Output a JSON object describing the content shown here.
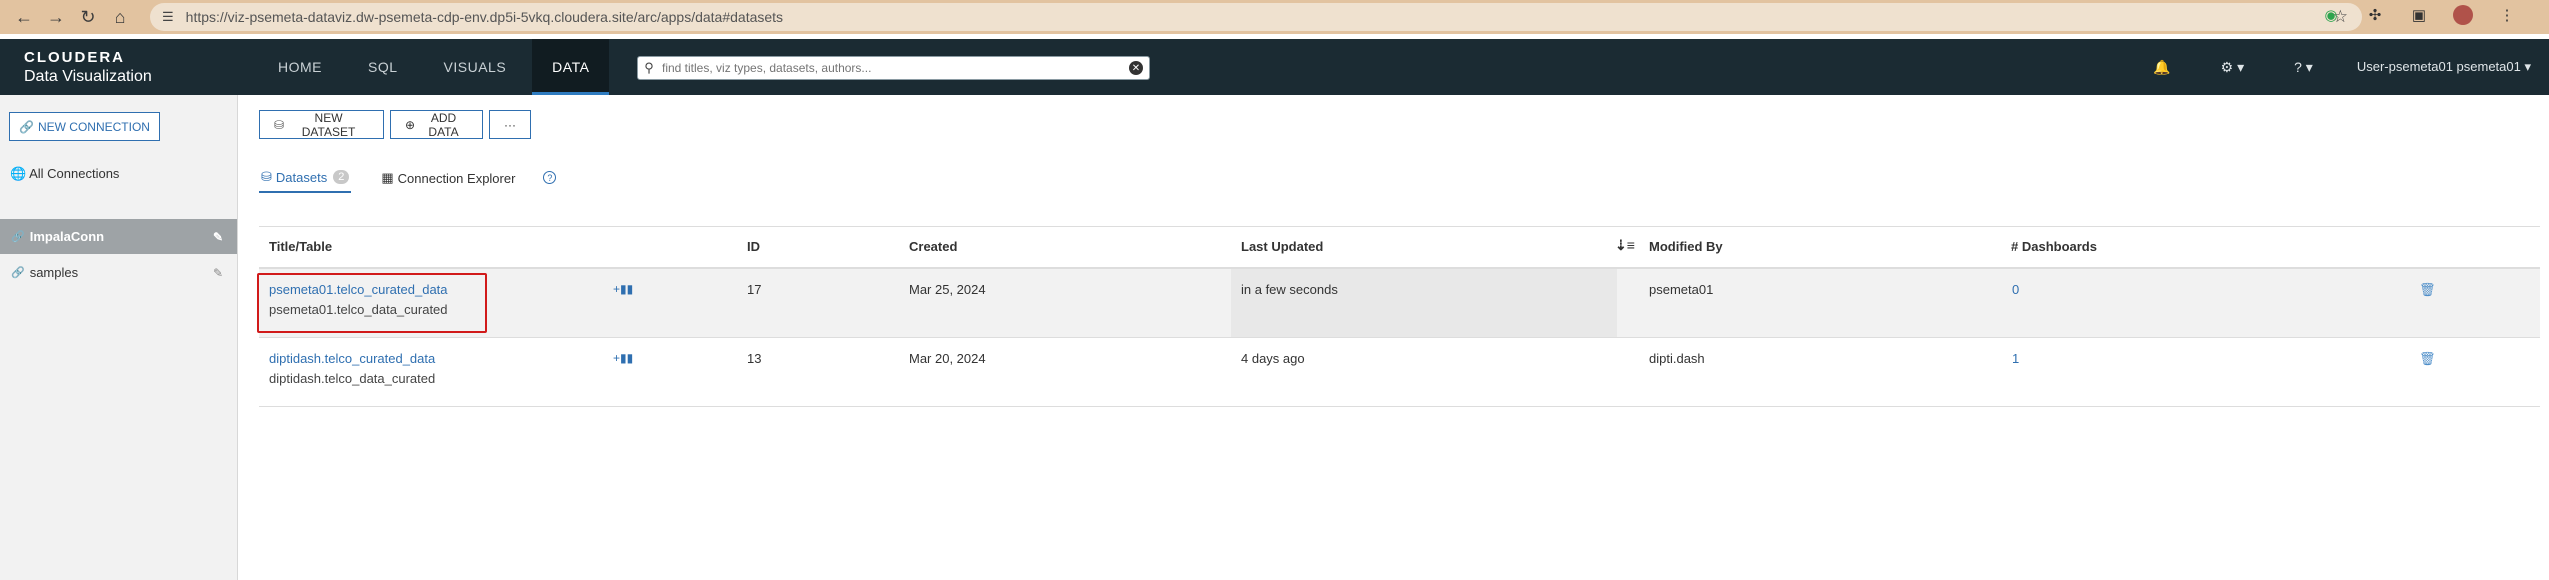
{
  "browser": {
    "url_host": "https://viz-psemeta-dataviz.dw-psemeta-cdp-env.dp5i-5vkq.cloudera.site",
    "url_path": "/arc/apps/data#datasets"
  },
  "header": {
    "logo": "CLOUDERA",
    "product": "Data Visualization",
    "tabs": [
      {
        "label": "HOME"
      },
      {
        "label": "SQL"
      },
      {
        "label": "VISUALS"
      },
      {
        "label": "DATA"
      }
    ],
    "search_placeholder": "find titles, viz types, datasets, authors...",
    "user_label": "User-psemeta01  psemeta01 ▾"
  },
  "sidebar": {
    "new_connection": "NEW CONNECTION",
    "all_connections": "All Connections",
    "connections": [
      {
        "label": "ImpalaConn"
      },
      {
        "label": "samples"
      }
    ]
  },
  "toolbar": {
    "new_dataset": "NEW DATASET",
    "add_data": "ADD DATA",
    "more": "···"
  },
  "tabs": {
    "datasets": "Datasets",
    "datasets_count": "2",
    "connection_explorer": "Connection Explorer"
  },
  "table": {
    "columns": {
      "title": "Title/Table",
      "id": "ID",
      "created": "Created",
      "last_updated": "Last Updated",
      "modified_by": "Modified By",
      "dashboards": "# Dashboards"
    },
    "rows": [
      {
        "title": "psemeta01.telco_curated_data",
        "table": "psemeta01.telco_data_curated",
        "id": "17",
        "created": "Mar 25, 2024",
        "last_updated": "in a few seconds",
        "modified_by": "psemeta01",
        "dashboards": "0"
      },
      {
        "title": "diptidash.telco_curated_data",
        "table": "diptidash.telco_data_curated",
        "id": "13",
        "created": "Mar 20, 2024",
        "last_updated": "4 days ago",
        "modified_by": "dipti.dash",
        "dashboards": "1"
      }
    ]
  }
}
